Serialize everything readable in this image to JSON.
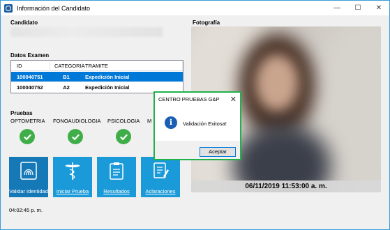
{
  "window": {
    "title": "Información del Candidato"
  },
  "candidate": {
    "label": "Candidato"
  },
  "exam": {
    "label": "Datos Examen",
    "columns": [
      "ID",
      "CATEGORIA",
      "TRAMITE"
    ],
    "rows": [
      {
        "id": "100040751",
        "category": "B1",
        "tramite": "Expedición Inicial"
      },
      {
        "id": "100040752",
        "category": "A2",
        "tramite": "Expedición Inicial"
      }
    ]
  },
  "tests": {
    "label": "Pruebas",
    "items": [
      "OPTOMETRIA",
      "FONOAUDIOLOGIA",
      "PSICOLOGIA",
      "M"
    ]
  },
  "actions": {
    "validate": "Validar Identidad",
    "start": "Iniciar Prueba",
    "results": "Resultados",
    "notes": "Aclaraciones"
  },
  "clock": "04:02:45 p. m.",
  "photo": {
    "label": "Fotografía",
    "timestamp": "06/11/2019 11:53:00 a. m."
  },
  "dialog": {
    "title": "CENTRO PRUEBAS G&P",
    "message": "Validación Exitosa!",
    "ok": "Aceptar"
  },
  "colors": {
    "accent": "#0078d7",
    "tile": "#1a9ad8",
    "check": "#3fae49",
    "dialog_border": "#21b14b"
  }
}
